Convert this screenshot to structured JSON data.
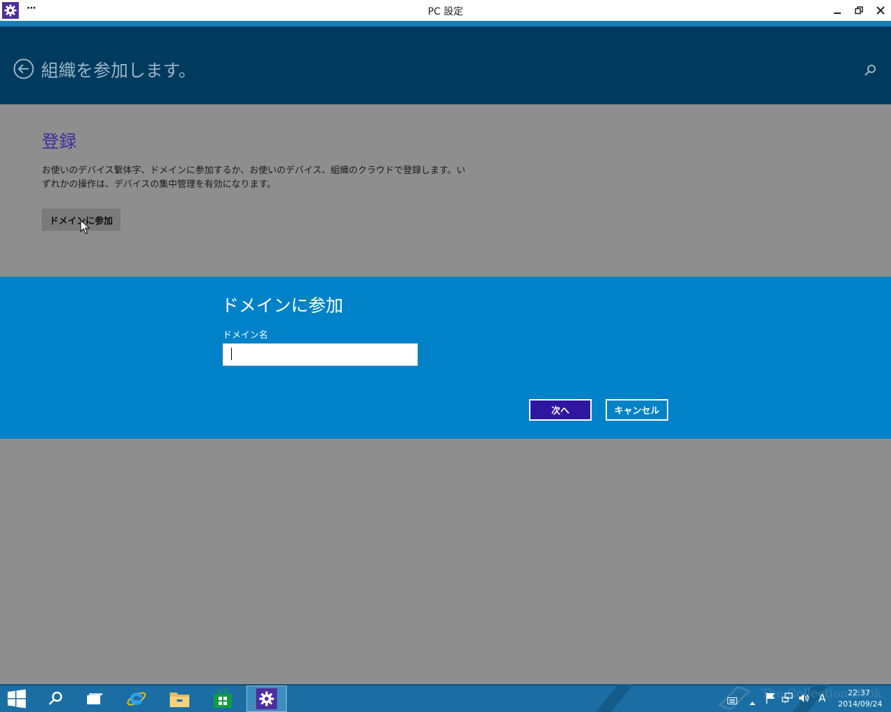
{
  "window": {
    "title": "PC 設定",
    "menu_dots": "···",
    "minimize_label": "—",
    "restore_label": "❐",
    "close_label": "✕"
  },
  "header": {
    "title": "組織を参加します。"
  },
  "enrollment": {
    "section_title": "登録",
    "description": "お使いのデバイス繋体字、ドメインに参加するか、お使いのデバイス、組織のクラウドで登録します。いずれかの操作は、デバイスの集中管理を有効になります。",
    "join_domain_button": "ドメインに参加"
  },
  "dialog": {
    "title": "ドメインに参加",
    "field_label": "ドメイン名",
    "domain_value": "",
    "next_button": "次へ",
    "cancel_button": "キャンセル"
  },
  "taskbar": {
    "apps": [
      "start-icon",
      "search-icon",
      "task-view-icon",
      "internet-explorer-icon",
      "file-explorer-icon",
      "store-icon",
      "settings-icon"
    ],
    "active_app": "settings-icon",
    "watermark": "The Collection Book",
    "time": "22:37",
    "date": "2014/09/24",
    "ime_indicator": "A"
  },
  "colors": {
    "header_bg": "#003a5e",
    "flyout_bg": "#0082c8",
    "accent": "#3d2d9e",
    "primary_button": "#2e16a0",
    "taskbar_bg": "#1b6ea3",
    "page_bg": "#8e8e8e"
  }
}
